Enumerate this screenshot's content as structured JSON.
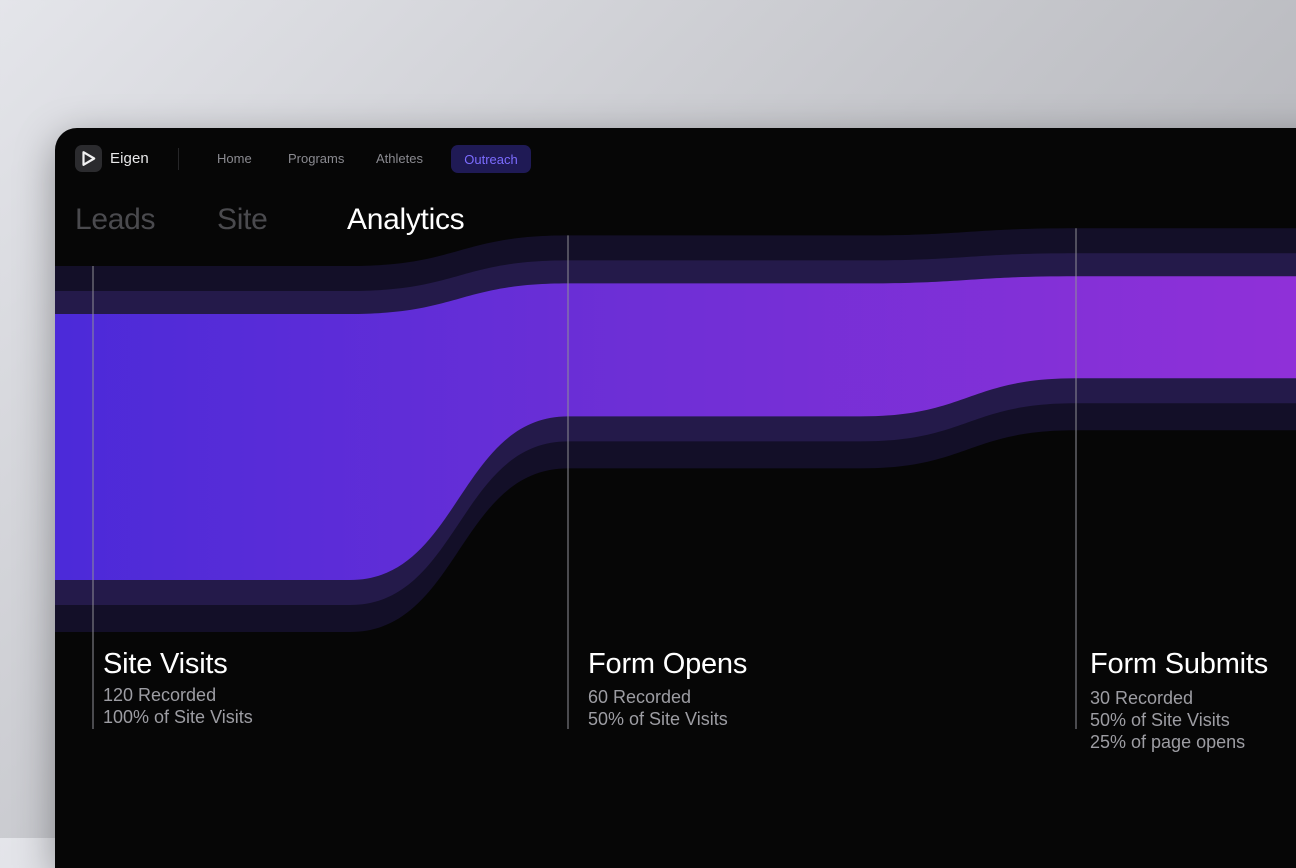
{
  "app": {
    "brand": "Eigen",
    "logo_icon": "play-icon"
  },
  "nav": {
    "items": [
      "Home",
      "Programs",
      "Athletes"
    ],
    "active": "Outreach"
  },
  "tabs": {
    "items": [
      "Leads",
      "Site"
    ],
    "active": "Analytics"
  },
  "funnel": {
    "colors": {
      "start": "#4b2ad9",
      "end": "#9330d8",
      "band_dark": "#130f28",
      "band_mid": "#241a4a"
    },
    "stages": [
      {
        "name": "Site Visits",
        "recorded": 120,
        "lines": [
          "120 Recorded",
          "100% of Site Visits"
        ]
      },
      {
        "name": "Form Opens",
        "recorded": 60,
        "lines": [
          "60 Recorded",
          "50% of Site Visits"
        ]
      },
      {
        "name": "Form Submits",
        "recorded": 30,
        "lines": [
          "30 Recorded",
          "50% of Site Visits",
          "25% of page opens"
        ]
      }
    ]
  }
}
